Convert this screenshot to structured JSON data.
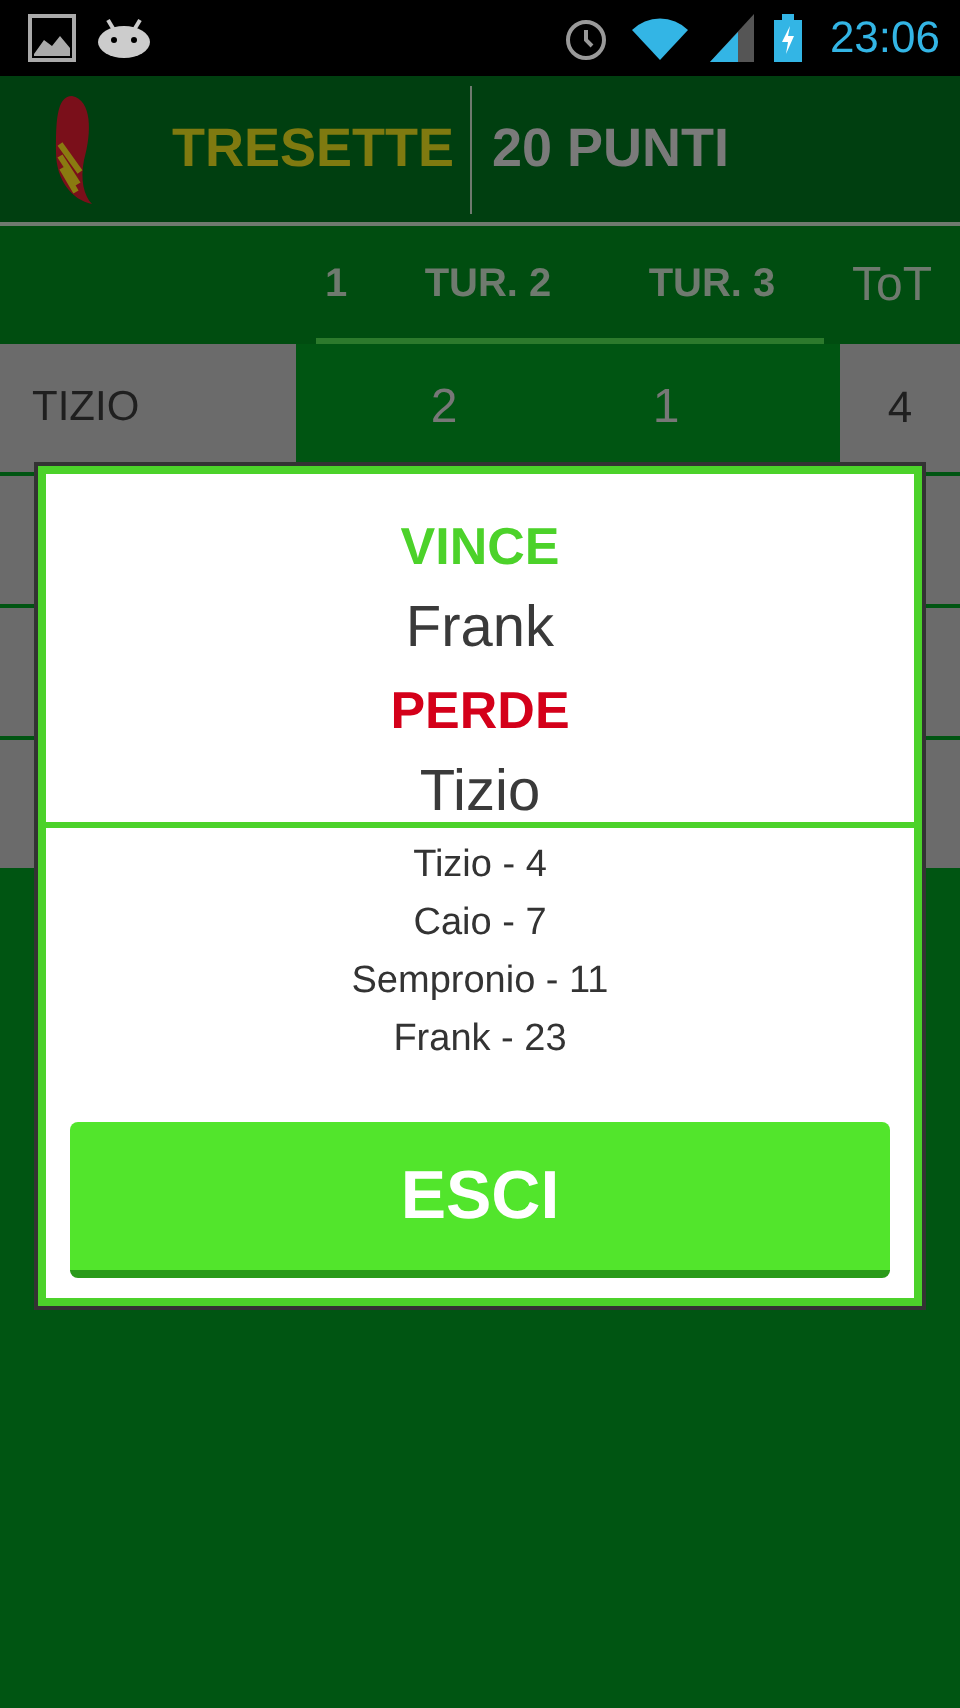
{
  "status_bar": {
    "time": "23:06"
  },
  "app_bar": {
    "title": "TRESETTE",
    "subtitle": "20 PUNTI"
  },
  "table": {
    "columns": [
      "1",
      "TUR. 2",
      "TUR. 3",
      "ToT"
    ],
    "rows": [
      {
        "name": "TIZIO",
        "values": [
          "2",
          "1"
        ],
        "total": "4"
      }
    ]
  },
  "dialog": {
    "winner_label": "VINCE",
    "winner": "Frank",
    "loser_label": "PERDE",
    "loser": "Tizio",
    "scores": [
      "Tizio - 4",
      "Caio - 7",
      "Sempronio - 11",
      "Frank - 23"
    ],
    "button": "ESCI"
  }
}
